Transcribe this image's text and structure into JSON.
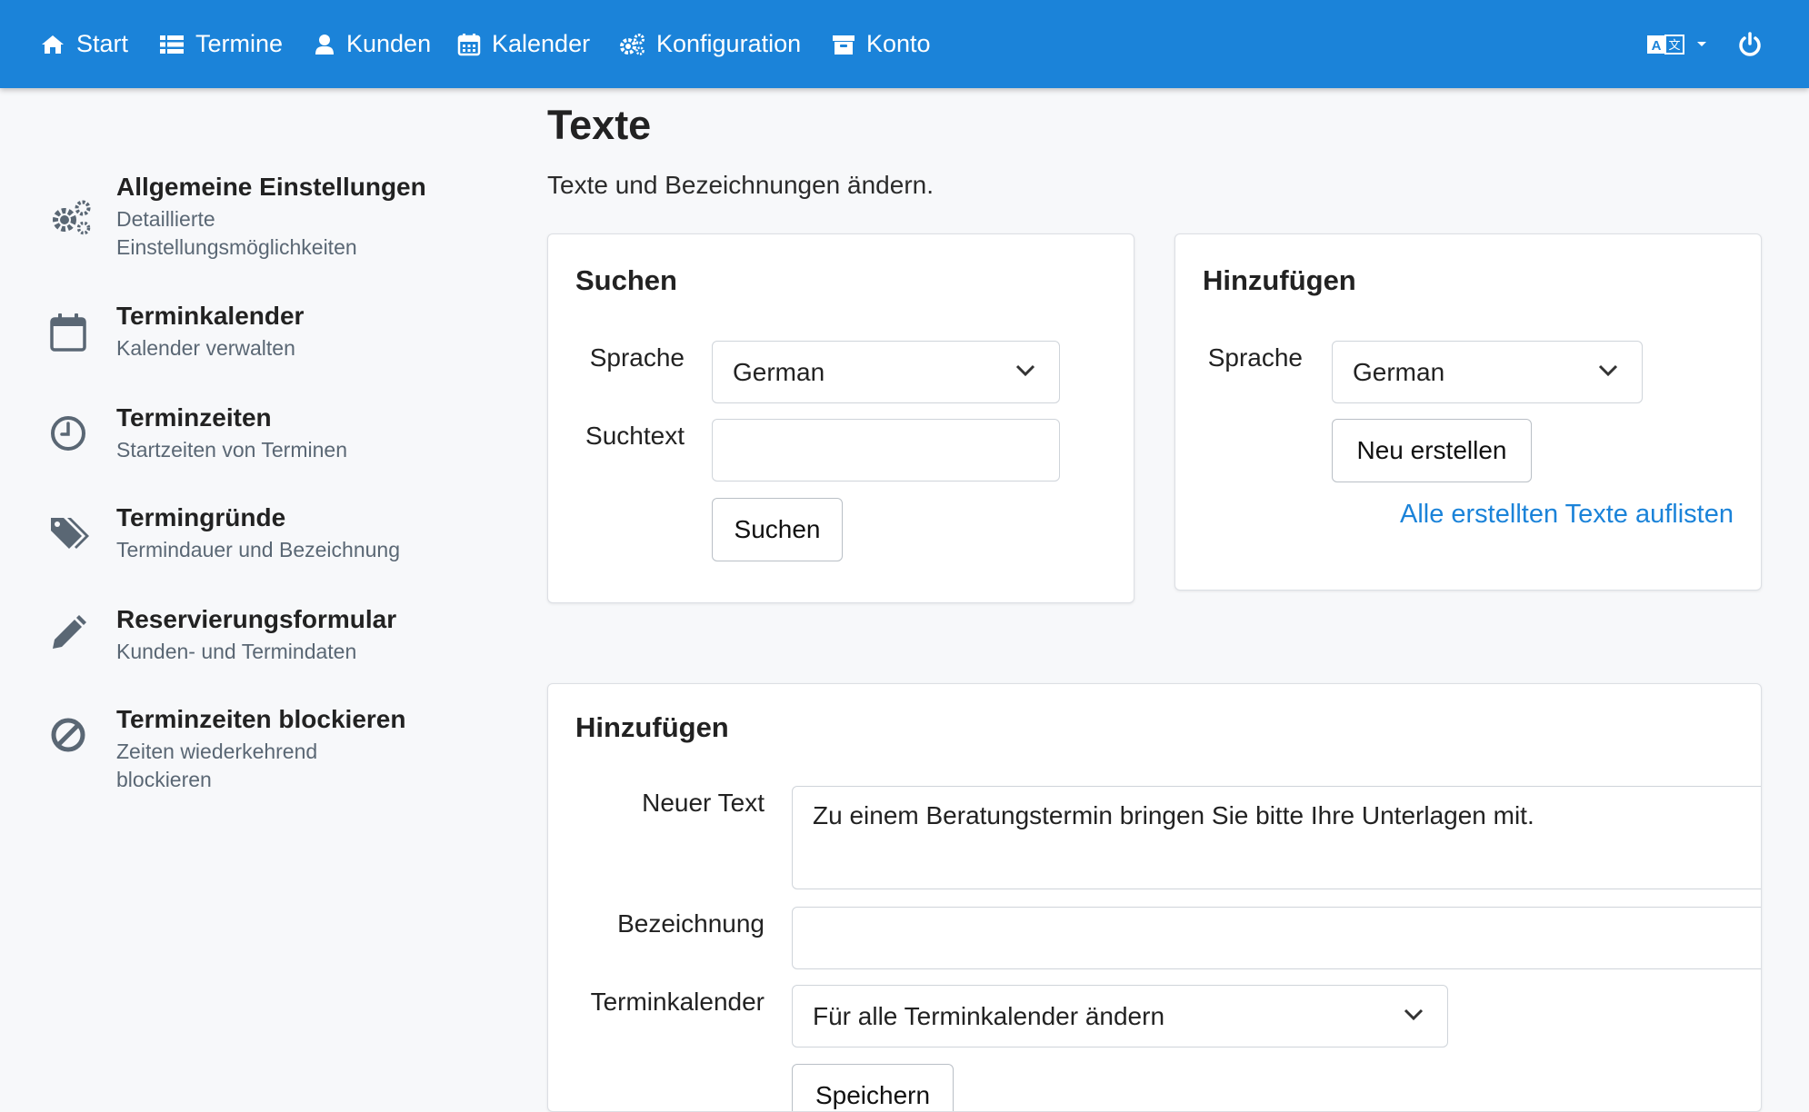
{
  "nav": {
    "items": [
      {
        "label": "Start",
        "icon": "home-icon"
      },
      {
        "label": "Termine",
        "icon": "list-icon"
      },
      {
        "label": "Kunden",
        "icon": "user-icon"
      },
      {
        "label": "Kalender",
        "icon": "calendar-icon"
      },
      {
        "label": "Konfiguration",
        "icon": "gears-icon"
      },
      {
        "label": "Konto",
        "icon": "archive-icon"
      }
    ],
    "language_icon": "language-icon",
    "power_icon": "power-icon"
  },
  "sidebar": {
    "items": [
      {
        "title": "Allgemeine Einstellungen",
        "subtitle": "Detaillierte Einstellungsmöglichkeiten",
        "icon": "gears-icon"
      },
      {
        "title": "Terminkalender",
        "subtitle": "Kalender verwalten",
        "icon": "calendar-icon"
      },
      {
        "title": "Terminzeiten",
        "subtitle": "Startzeiten von Terminen",
        "icon": "clock-icon"
      },
      {
        "title": "Termingründe",
        "subtitle": "Termindauer und Bezeichnung",
        "icon": "tags-icon"
      },
      {
        "title": "Reservierungsformular",
        "subtitle": "Kunden- und Termindaten",
        "icon": "pencil-icon"
      },
      {
        "title": "Terminzeiten blockieren",
        "subtitle": "Zeiten wiederkehrend blockieren",
        "icon": "ban-icon"
      }
    ]
  },
  "page": {
    "title": "Texte",
    "description": "Texte und Bezeichnungen ändern."
  },
  "search_card": {
    "title": "Suchen",
    "language_label": "Sprache",
    "language_value": "German",
    "searchtext_label": "Suchtext",
    "searchtext_value": "",
    "search_button": "Suchen"
  },
  "add_card": {
    "title": "Hinzufügen",
    "language_label": "Sprache",
    "language_value": "German",
    "create_button": "Neu erstellen",
    "list_link": "Alle erstellten Texte auflisten"
  },
  "add_form": {
    "title": "Hinzufügen",
    "new_text_label": "Neuer Text",
    "new_text_value": "Zu einem Beratungstermin bringen Sie bitte Ihre Unterlagen mit.",
    "designation_label": "Bezeichnung",
    "designation_value": "",
    "calendar_label": "Terminkalender",
    "calendar_value": "Für alle Terminkalender ändern",
    "save_button": "Speichern"
  },
  "colors": {
    "navbar": "#1b83d9",
    "link": "#1b83d9",
    "background": "#f7f8fa",
    "sidebar_icon": "#5a6774"
  }
}
